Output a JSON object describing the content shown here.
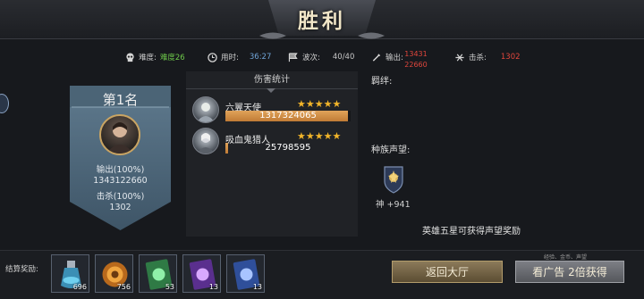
{
  "header": {
    "title": "胜利"
  },
  "stats": {
    "difficulty": {
      "label": "难度:",
      "value": "难度26",
      "value_color": "#6ec94a",
      "icon": "skull-icon"
    },
    "time": {
      "label": "用时:",
      "value": "36:27",
      "value_color": "#6fa3d6",
      "icon": "clock-icon"
    },
    "waves": {
      "label": "波次:",
      "value": "40/40",
      "value_color": "#c8c8c8",
      "icon": "flag-icon"
    },
    "output": {
      "label": "输出:",
      "value": "1343122660",
      "value_color": "#e0463c",
      "icon": "sword-icon"
    },
    "kills": {
      "label": "击杀:",
      "value": "1302",
      "value_color": "#e0463c",
      "icon": "crossbow-icon"
    }
  },
  "mvp": {
    "rank": "第1名",
    "damage_label": "输出(100%)",
    "damage_value": "1343122660",
    "kills_label": "击杀(100%)",
    "kills_value": "1302"
  },
  "damage_stats": {
    "title": "伤害统计",
    "rows": [
      {
        "name": "六翼天使",
        "stars": 5,
        "value": "1317324065",
        "share": 0.98
      },
      {
        "name": "吸血鬼猎人",
        "stars": 5,
        "value": "25798595",
        "share": 0.02
      }
    ]
  },
  "bond_label": "羁绊:",
  "reputation": {
    "label": "种族声望:",
    "gain": "神 +941",
    "note": "英雄五星可获得声望奖励"
  },
  "footer": {
    "reward_label": "结算奖励:",
    "items": [
      {
        "name": "potion-icon",
        "count": "696",
        "color": "#5fb8d8"
      },
      {
        "name": "medal-icon",
        "count": "756",
        "color": "#d18a2e"
      },
      {
        "name": "green-card-icon",
        "count": "53",
        "color": "#4fbf6a"
      },
      {
        "name": "purple-card-icon",
        "count": "13",
        "color": "#9a5fd8"
      },
      {
        "name": "blue-card-icon",
        "count": "13",
        "color": "#5a86e0"
      }
    ],
    "back_button": "返回大厅",
    "ad_button": "看广告 2倍获得",
    "ad_tip": "经验、金币、声望"
  }
}
